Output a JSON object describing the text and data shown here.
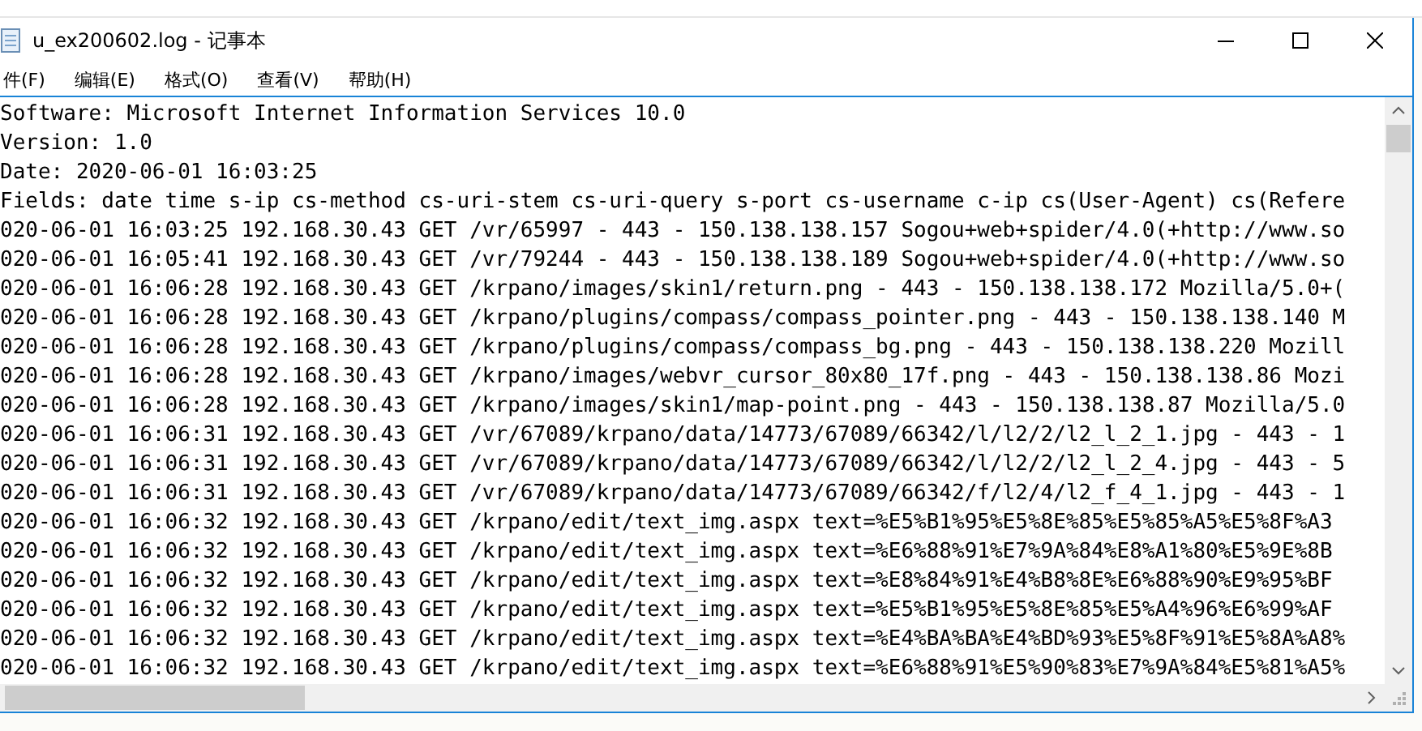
{
  "window": {
    "title": "u_ex200602.log - 记事本"
  },
  "menu": [
    "件(F)",
    "编辑(E)",
    "格式(O)",
    "查看(V)",
    "帮助(H)"
  ],
  "lines": [
    "Software: Microsoft Internet Information Services 10.0",
    "Version: 1.0",
    "Date: 2020-06-01 16:03:25",
    "Fields: date time s-ip cs-method cs-uri-stem cs-uri-query s-port cs-username c-ip cs(User-Agent) cs(Refere",
    "020-06-01 16:03:25 192.168.30.43 GET /vr/65997 - 443 - 150.138.138.157 Sogou+web+spider/4.0(+http://www.so",
    "020-06-01 16:05:41 192.168.30.43 GET /vr/79244 - 443 - 150.138.138.189 Sogou+web+spider/4.0(+http://www.so",
    "020-06-01 16:06:28 192.168.30.43 GET /krpano/images/skin1/return.png - 443 - 150.138.138.172 Mozilla/5.0+(",
    "020-06-01 16:06:28 192.168.30.43 GET /krpano/plugins/compass/compass_pointer.png - 443 - 150.138.138.140 M",
    "020-06-01 16:06:28 192.168.30.43 GET /krpano/plugins/compass/compass_bg.png - 443 - 150.138.138.220 Mozill",
    "020-06-01 16:06:28 192.168.30.43 GET /krpano/images/webvr_cursor_80x80_17f.png - 443 - 150.138.138.86 Mozi",
    "020-06-01 16:06:28 192.168.30.43 GET /krpano/images/skin1/map-point.png - 443 - 150.138.138.87 Mozilla/5.0",
    "020-06-01 16:06:31 192.168.30.43 GET /vr/67089/krpano/data/14773/67089/66342/l/l2/2/l2_l_2_1.jpg - 443 - 1",
    "020-06-01 16:06:31 192.168.30.43 GET /vr/67089/krpano/data/14773/67089/66342/l/l2/2/l2_l_2_4.jpg - 443 - 5",
    "020-06-01 16:06:31 192.168.30.43 GET /vr/67089/krpano/data/14773/67089/66342/f/l2/4/l2_f_4_1.jpg - 443 - 1",
    "020-06-01 16:06:32 192.168.30.43 GET /krpano/edit/text_img.aspx text=%E5%B1%95%E5%8E%85%E5%85%A5%E5%8F%A3",
    "020-06-01 16:06:32 192.168.30.43 GET /krpano/edit/text_img.aspx text=%E6%88%91%E7%9A%84%E8%A1%80%E5%9E%8B",
    "020-06-01 16:06:32 192.168.30.43 GET /krpano/edit/text_img.aspx text=%E8%84%91%E4%B8%8E%E6%88%90%E9%95%BF",
    "020-06-01 16:06:32 192.168.30.43 GET /krpano/edit/text_img.aspx text=%E5%B1%95%E5%8E%85%E5%A4%96%E6%99%AF",
    "020-06-01 16:06:32 192.168.30.43 GET /krpano/edit/text_img.aspx text=%E4%BA%BA%E4%BD%93%E5%8F%91%E5%8A%A8%",
    "020-06-01 16:06:32 192.168.30.43 GET /krpano/edit/text_img.aspx text=%E6%88%91%E5%90%83%E7%9A%84%E5%81%A5%"
  ]
}
